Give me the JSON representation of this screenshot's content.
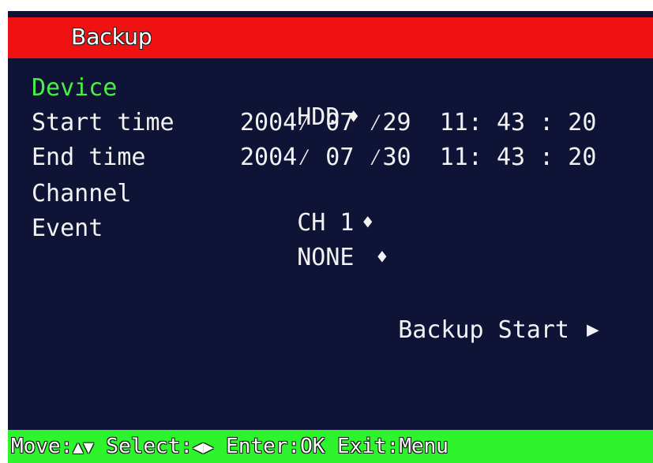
{
  "title": "Backup",
  "fields": [
    {
      "label": "Device",
      "value": "HDD",
      "arrows": "♦"
    },
    {
      "label": "Start time",
      "value": "2004⁄ 07 ⁄29  11: 43 : 20"
    },
    {
      "label": "End time",
      "value": "2004⁄ 07 ⁄30  11: 43 : 20"
    },
    {
      "label": "Channel",
      "value": "CH 1",
      "arrows": "♦"
    },
    {
      "label": "Event",
      "value": "NONE ",
      "arrows": "♦"
    }
  ],
  "action": {
    "label": "Backup Start",
    "icon": "play-icon"
  },
  "help": {
    "move_label": "Move:",
    "move_keys": "▲▼",
    "select_label": " Select:",
    "select_keys": "◀▶",
    "enter": " Enter:OK",
    "exit": " Exit:Menu"
  },
  "colors": {
    "background": "#0f1437",
    "title_bar": "#f01212",
    "status_bar": "#2df42d",
    "selected": "#46f046",
    "text": "#f2f2f2"
  }
}
